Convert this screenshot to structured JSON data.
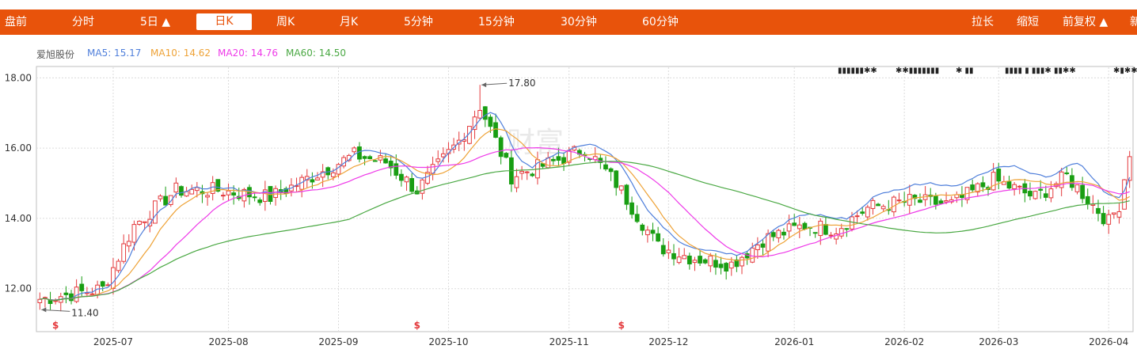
{
  "toolbar": {
    "tabs": [
      {
        "label": "盘前"
      },
      {
        "label": "分时"
      },
      {
        "label": "5日 ▲"
      },
      {
        "label": "日K",
        "active": true
      },
      {
        "label": "周K"
      },
      {
        "label": "月K"
      },
      {
        "label": "5分钟"
      },
      {
        "label": "15分钟"
      },
      {
        "label": "30分钟"
      },
      {
        "label": "60分钟"
      }
    ],
    "right_tabs": [
      {
        "label": "拉长"
      },
      {
        "label": "缩短"
      },
      {
        "label": "前复权 ▲"
      },
      {
        "label": "新"
      }
    ],
    "bg_color": "#e8530b"
  },
  "legend": {
    "stock_name": "爱旭股份",
    "ma5": "MA5: 15.17",
    "ma10": "MA10: 14.62",
    "ma20": "MA20: 14.76",
    "ma60": "MA60: 14.50"
  },
  "watermark": "财富",
  "chart_data": {
    "type": "candlestick",
    "title": "",
    "xlabel": "",
    "ylabel": "",
    "ylim": [
      10.8,
      18.3
    ],
    "yticks": [
      "12.00",
      "14.00",
      "16.00",
      "18.00"
    ],
    "xticks": [
      "2025-07",
      "2025-08",
      "2025-09",
      "2025-10",
      "2025-11",
      "2025-12",
      "2026-01",
      "2026-02",
      "2026-03",
      "2026-04"
    ],
    "grid": true,
    "annotations": [
      {
        "label": "17.80",
        "value": 17.8,
        "kind": "high"
      },
      {
        "label": "11.40",
        "value": 11.4,
        "kind": "low"
      }
    ],
    "close_keypoints": [
      [
        0,
        11.7
      ],
      [
        12,
        12.0
      ],
      [
        18,
        13.8
      ],
      [
        26,
        14.8
      ],
      [
        34,
        14.8
      ],
      [
        44,
        14.6
      ],
      [
        52,
        15.2
      ],
      [
        60,
        15.8
      ],
      [
        66,
        15.6
      ],
      [
        72,
        14.8
      ],
      [
        80,
        16.2
      ],
      [
        84,
        17.2
      ],
      [
        90,
        15.2
      ],
      [
        98,
        15.6
      ],
      [
        104,
        16.0
      ],
      [
        110,
        15.0
      ],
      [
        118,
        13.2
      ],
      [
        124,
        12.9
      ],
      [
        132,
        12.7
      ],
      [
        138,
        13.4
      ],
      [
        146,
        13.8
      ],
      [
        152,
        13.7
      ],
      [
        158,
        14.3
      ],
      [
        166,
        14.5
      ],
      [
        174,
        14.4
      ],
      [
        182,
        15.1
      ],
      [
        190,
        14.6
      ],
      [
        196,
        15.2
      ],
      [
        204,
        13.9
      ],
      [
        206,
        14.4
      ],
      [
        208,
        15.9
      ]
    ],
    "series": [
      {
        "name": "MA5",
        "color": "#4f7fdb",
        "last": 15.17
      },
      {
        "name": "MA10",
        "color": "#eea236",
        "last": 14.62
      },
      {
        "name": "MA20",
        "color": "#ee3ae8",
        "last": 14.76
      },
      {
        "name": "MA60",
        "color": "#4aa843",
        "last": 14.5
      }
    ],
    "up_color": "#e4393c",
    "down_color": "#199e13",
    "event_markers": [
      {
        "label": "$",
        "date_index": 3
      },
      {
        "label": "$",
        "date_index": 72
      },
      {
        "label": "$",
        "date_index": 111
      }
    ],
    "top_marker_groups": [
      {
        "label": "▮▮▮▮▮▮✱✱"
      },
      {
        "label": "✱✱▮▮▮▮▮▮▮"
      },
      {
        "label": "✱ ▮▮"
      },
      {
        "label": "▮▮▮▮ ▮ ▮▮▮✱ ▮▮✱✱"
      },
      {
        "label": "✱▮✱✱"
      }
    ]
  }
}
